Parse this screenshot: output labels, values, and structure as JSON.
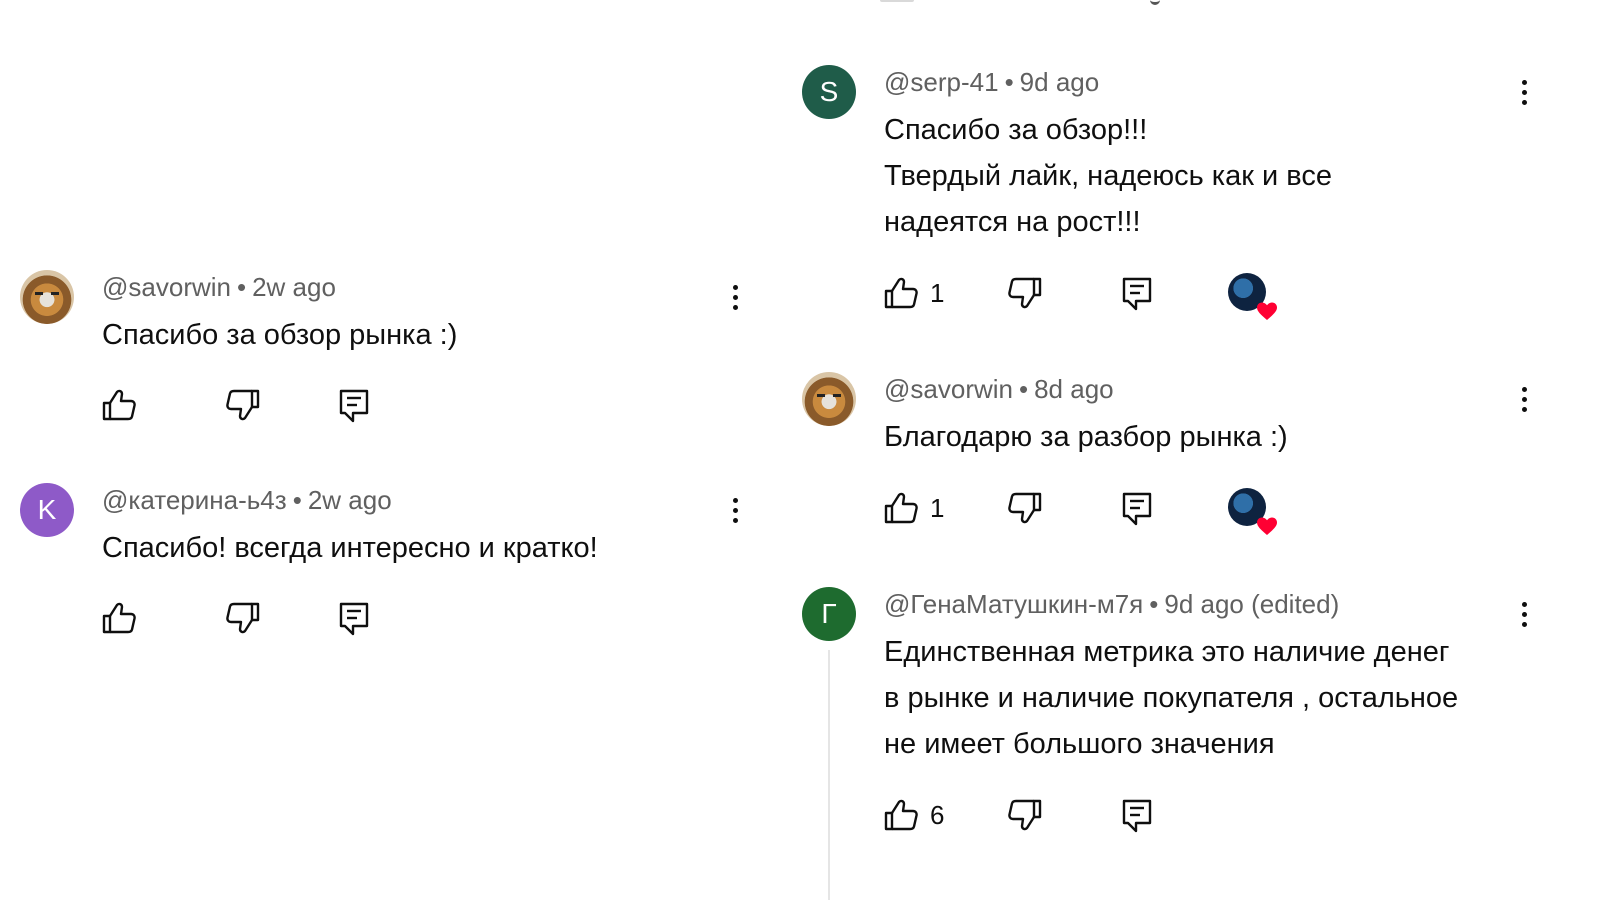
{
  "colors": {
    "avatar_S": "#1f5c49",
    "avatar_K": "#8e5ac8",
    "avatar_G": "#1e6b2f",
    "meta_text": "#606060"
  },
  "left_comments": [
    {
      "avatar_letter": "",
      "avatar_kind": "tiger",
      "author": "@savorwin",
      "time": "2w ago",
      "text": "Спасибо за обзор рынка :)"
    },
    {
      "avatar_letter": "K",
      "avatar_kind": "letter",
      "author": "@катерина-ь4з",
      "time": "2w ago",
      "text": "Спасибо! всегда интересно и кратко!"
    }
  ],
  "right_comments": [
    {
      "avatar_letter": "S",
      "author": "@serp-41",
      "time": "9d ago",
      "lines": [
        "Спасибо за обзор!!!",
        "Твердый лайк, надеюсь как и все",
        "надеятся на рост!!!"
      ],
      "likes": "1",
      "creator_heart": true
    },
    {
      "avatar_letter": "",
      "avatar_kind": "tiger",
      "author": "@savorwin",
      "time": "8d ago",
      "lines": [
        "Благодарю за разбор рынка :)"
      ],
      "likes": "1",
      "creator_heart": true
    },
    {
      "avatar_letter": "Г",
      "author": "@ГенаМатушкин-м7я",
      "time": "9d ago (edited)",
      "lines": [
        "Единственная метрика это наличие денег",
        "в рынке и наличие покупателя , остальное",
        "не имеет большого значения"
      ],
      "likes": "6",
      "creator_heart": false
    }
  ],
  "meta_separator": "•",
  "icons": {
    "like": "thumbs-up-icon",
    "dislike": "thumbs-down-icon",
    "reply": "reply-comment-icon",
    "more": "more-vertical-icon",
    "heart": "creator-heart-icon"
  }
}
